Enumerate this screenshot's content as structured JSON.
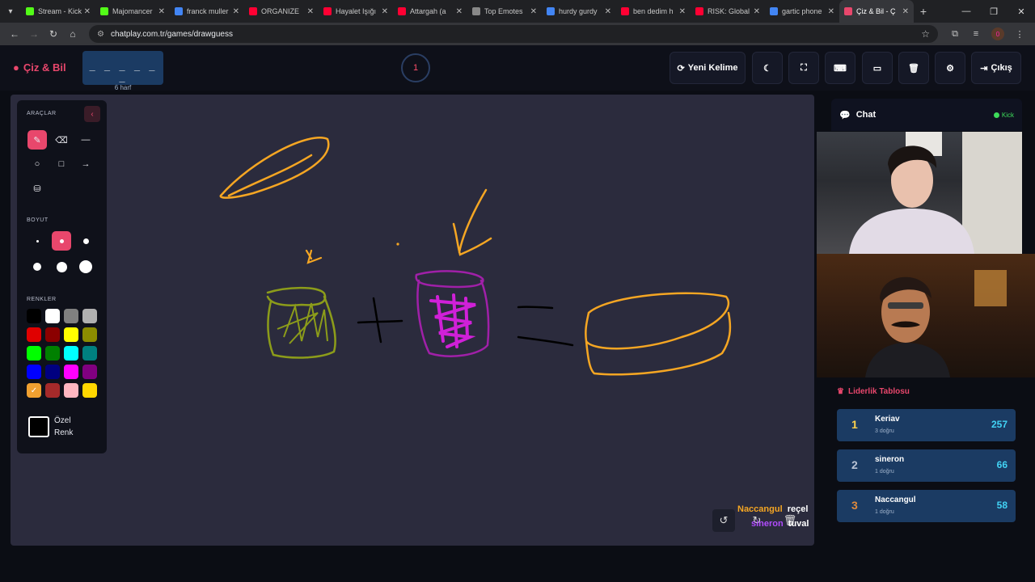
{
  "browser": {
    "tabs": [
      {
        "label": "Stream - Kick",
        "color": "#53fc18"
      },
      {
        "label": "Majomancer",
        "color": "#53fc18"
      },
      {
        "label": "franck muller",
        "color": "#4285f4"
      },
      {
        "label": "ORGANIZE",
        "color": "#ff0033"
      },
      {
        "label": "Hayalet Işığı",
        "color": "#ff0033"
      },
      {
        "label": "Attargah (a",
        "color": "#ff0033"
      },
      {
        "label": "Top Emotes",
        "color": "#888888"
      },
      {
        "label": "hurdy gurdy",
        "color": "#4285f4"
      },
      {
        "label": "ben dedim h",
        "color": "#ff0033"
      },
      {
        "label": "RISK: Global",
        "color": "#ff0033"
      },
      {
        "label": "gartic phone",
        "color": "#4285f4"
      },
      {
        "label": "Çiz & Bil - Ç",
        "color": "#e8476c"
      }
    ],
    "url": "chatplay.com.tr/games/drawguess",
    "profile_initial": "0"
  },
  "header": {
    "logo": "Çiz & Bil",
    "word_blanks": "_ _ _ _ _ _",
    "word_hint": "6 harf",
    "round": "1",
    "buttons": {
      "new_word": "Yeni Kelime",
      "exit": "Çıkış"
    }
  },
  "tools": {
    "title": "ARAÇLAR",
    "size_title": "BOYUT",
    "colors_title": "RENKLER",
    "custom_color": [
      "Özel",
      "Renk"
    ],
    "palette": [
      "#000000",
      "#ffffff",
      "#808080",
      "#b0b0b0",
      "#e00000",
      "#8b0000",
      "#ffff00",
      "#8c8c00",
      "#00ff00",
      "#008000",
      "#00ffff",
      "#008080",
      "#0000ff",
      "#000080",
      "#ff00ff",
      "#800080",
      "#f0a030",
      "#a52a2a",
      "#ffb6c1",
      "#ffd700"
    ]
  },
  "canvas_overlay": {
    "guesses": [
      {
        "name": "Naccangul",
        "word": "reçel",
        "name_color": "#f5a623"
      },
      {
        "name": "sineron",
        "word": "tuval",
        "name_color": "#b14cff"
      }
    ]
  },
  "chat": {
    "title": "Chat",
    "platform": "Kick"
  },
  "leaderboard": {
    "title": "Liderlik Tablosu",
    "rows": [
      {
        "rank": "1",
        "name": "Keriav",
        "sub": "3 doğru",
        "points": "257",
        "rank_color": "#ffd34d"
      },
      {
        "rank": "2",
        "name": "sineron",
        "sub": "1 doğru",
        "points": "66",
        "rank_color": "#b9c3d4"
      },
      {
        "rank": "3",
        "name": "Naccangul",
        "sub": "1 doğru",
        "points": "58",
        "rank_color": "#e08a3c"
      }
    ]
  }
}
